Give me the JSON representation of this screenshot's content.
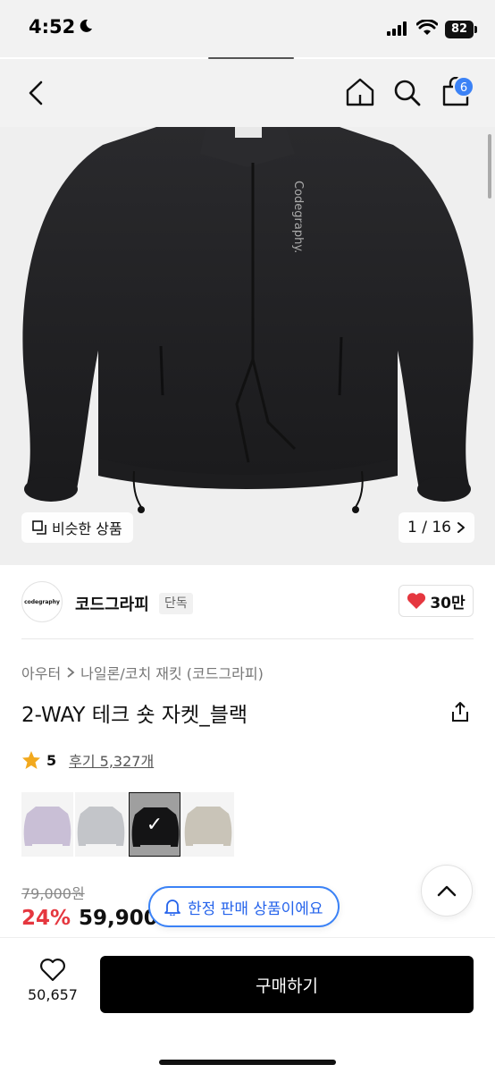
{
  "status": {
    "time": "4:52",
    "battery": "82"
  },
  "header": {
    "cart_count": "6"
  },
  "gallery": {
    "similar_label": "비슷한 상품",
    "counter": "1 / 16"
  },
  "brand": {
    "name": "코드그라피",
    "tag": "단독",
    "logo_text": "codegraphy",
    "likes": "30만"
  },
  "product": {
    "breadcrumb": [
      "아우터",
      "나일론/코치 재킷 (코드그라피)"
    ],
    "title": "2-WAY 테크 숏 자켓_블랙",
    "rating": "5",
    "reviews": "후기 5,327개",
    "colors": [
      {
        "name": "lavender",
        "hex": "#c9bfd6"
      },
      {
        "name": "gray",
        "hex": "#c3c5c9"
      },
      {
        "name": "black",
        "hex": "#1f1f21",
        "selected": true
      },
      {
        "name": "beige",
        "hex": "#c9c4b8"
      }
    ]
  },
  "price": {
    "original": "79,000원",
    "discount": "24%",
    "final": "59,900"
  },
  "limited_label": "한정 판매 상품이에요",
  "bottom": {
    "wishlist_count": "50,657",
    "buy_label": "구매하기"
  }
}
